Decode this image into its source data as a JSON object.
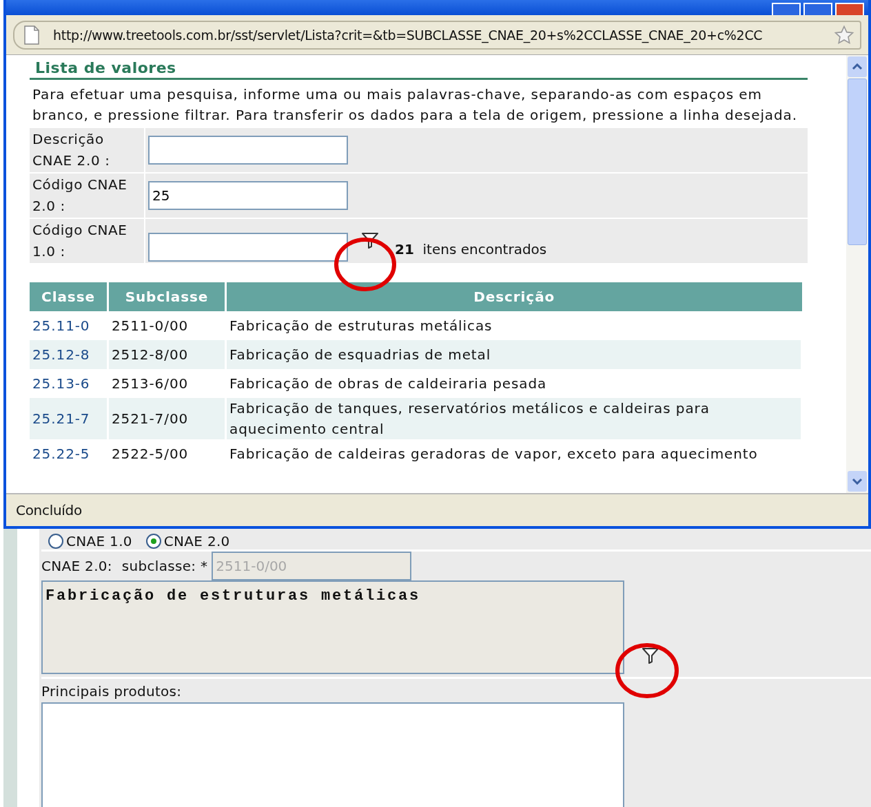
{
  "browser": {
    "address": "http://www.treetools.com.br/sst/servlet/Lista?crit=&tb=SUBCLASSE_CNAE_20+s%2CCLASSE_CNAE_20+c%2CC",
    "status": "Concluído"
  },
  "popup": {
    "title": "Lista de valores",
    "instructions": "Para efetuar uma pesquisa, informe uma ou mais palavras-chave, separando-as com espaços em branco, e pressione filtrar. Para transferir os dados para a tela de origem, pressione a linha desejada.",
    "filters": [
      {
        "label": "Descrição CNAE 2.0 :"
      },
      {
        "label": "Código CNAE 2.0 :",
        "value": "25"
      },
      {
        "label": "Código CNAE 1.0 :"
      }
    ],
    "result_count": "**21**  itens encontrados",
    "table": {
      "columns": [
        "Classe",
        "Subclasse",
        "Descrição"
      ],
      "rows": [
        {
          "classe": "25.11-0",
          "subclasse": "2511-0/00",
          "descricao": "Fabricação de estruturas metálicas"
        },
        {
          "classe": "25.12-8",
          "subclasse": "2512-8/00",
          "descricao": "Fabricação de esquadrias de metal"
        },
        {
          "classe": "25.13-6",
          "subclasse": "2513-6/00",
          "descricao": "Fabricação de obras de caldeiraria pesada"
        },
        {
          "classe": "25.21-7",
          "subclasse": "2521-7/00",
          "descricao": "Fabricação de tanques, reservatórios metálicos e caldeiras para aquecimento central"
        },
        {
          "classe": "25.22-5",
          "subclasse": "2522-5/00",
          "descricao": "Fabricação de caldeiras geradoras de vapor, exceto para aquecimento"
        }
      ]
    }
  },
  "form": {
    "options": [
      {
        "label": "CNAE 1.0",
        "selected": false
      },
      {
        "label": "CNAE 2.0",
        "selected": true
      }
    ],
    "version_label": "CNAE 2.0:",
    "subclass_label": "subclasse: *",
    "subclass_value": "2511-0/00",
    "subclass_disabled": true,
    "description_value": "Fabricação de estruturas metálicas",
    "products_label": "Principais produtos:"
  }
}
